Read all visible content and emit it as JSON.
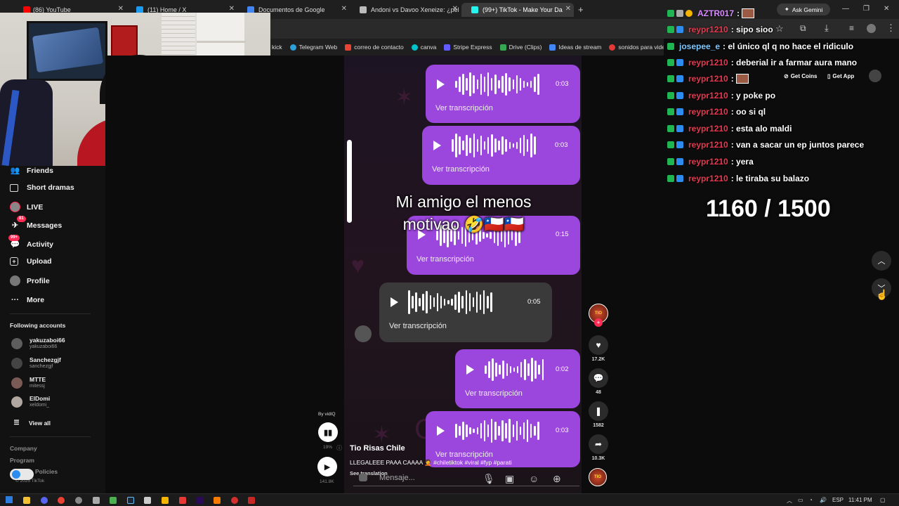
{
  "browser": {
    "tabs": [
      {
        "title": "(86) YouTube",
        "color": "#ff0000"
      },
      {
        "title": "(11) Home / X",
        "color": "#1d9bf0"
      },
      {
        "title": "Documentos de Google",
        "color": "#4285f4"
      },
      {
        "title": "Andoni vs Davoo Xeneize: ¿pel",
        "color": "#bbbbbb"
      },
      {
        "title": "(99+) TikTok - Make Your Da",
        "color": "#25f4ee"
      }
    ],
    "bookmarks": [
      {
        "label": "kick",
        "color": "#53fc18"
      },
      {
        "label": "Telegram Web",
        "color": "#2aa1da"
      },
      {
        "label": "correo de contacto",
        "color": "#ea4335"
      },
      {
        "label": "canva",
        "color": "#00c4cc"
      },
      {
        "label": "Stripe Express",
        "color": "#635bff"
      },
      {
        "label": "Drive (Clips)",
        "color": "#34a853"
      },
      {
        "label": "Ideas de stream",
        "color": "#4285f4"
      },
      {
        "label": "sonidos para videos",
        "color": "#e53935"
      }
    ],
    "gemini_label": "Ask Gemini"
  },
  "sidebar": {
    "items": [
      {
        "label": "Friends",
        "icon": "friends-icon"
      },
      {
        "label": "Short dramas",
        "icon": "short-dramas-icon"
      },
      {
        "label": "LIVE",
        "icon": "live-icon"
      },
      {
        "label": "Messages",
        "icon": "messages-icon",
        "badge": "81"
      },
      {
        "label": "Activity",
        "icon": "activity-icon",
        "badge": "99+"
      },
      {
        "label": "Upload",
        "icon": "upload-icon"
      },
      {
        "label": "Profile",
        "icon": "profile-icon"
      },
      {
        "label": "More",
        "icon": "more-icon"
      }
    ],
    "following_title": "Following accounts",
    "accounts": [
      {
        "name": "yakuzaboi66",
        "handle": "yakuzaboi66"
      },
      {
        "name": "Sanchezgjf",
        "handle": "sanchezgjf"
      },
      {
        "name": "MTTE",
        "handle": "mitessj"
      },
      {
        "name": "ElDomi",
        "handle": "xeldomi_"
      }
    ],
    "view_all": "View all",
    "footer": [
      "Company",
      "Program",
      "Policies"
    ],
    "copyright": "© 2025 TikTok"
  },
  "video": {
    "caption_line1": "Mi amigo el menos",
    "caption_line2": "motivao 🤣🇨🇱🇨🇱",
    "transcription_label": "Ver transcripción",
    "durations": [
      "0:03",
      "0:03",
      "0:15",
      "0:05",
      "0:02",
      "0:03"
    ],
    "by_label": "By vidIQ",
    "views_pct": "19%",
    "views": "141.8K",
    "author": "Tio Risas Chile",
    "description": "LLEGALEEE PAAA CAAAA 🤦 #chiletiktok #viral #fyp #parati",
    "see_translation": "See translation",
    "message_placeholder": "Mensaje..."
  },
  "actions": {
    "likes": "17.2K",
    "comments": "48",
    "saves": "1582",
    "shares": "10.3K"
  },
  "tiktok_header": {
    "get_coins": "Get Coins",
    "get_app": "Get App"
  },
  "chat": [
    {
      "user": "AZTR017",
      "msg": "",
      "user_color": "#d88cff"
    },
    {
      "user": "reypr1210",
      "msg": ": sipo sioo",
      "user_color": "#e8384f"
    },
    {
      "user": "josepee_e",
      "msg": ": el único ql q no hace el ridiculo",
      "user_color": "#7ec8ff"
    },
    {
      "user": "reypr1210",
      "msg": ": deberial ir a farmar aura mano",
      "user_color": "#e8384f"
    },
    {
      "user": "reypr1210",
      "msg": ":",
      "user_color": "#e8384f"
    },
    {
      "user": "reypr1210",
      "msg": ": y poke po",
      "user_color": "#e8384f"
    },
    {
      "user": "reypr1210",
      "msg": ": oo si ql",
      "user_color": "#e8384f"
    },
    {
      "user": "reypr1210",
      "msg": ": esta alo maldi",
      "user_color": "#e8384f"
    },
    {
      "user": "reypr1210",
      "msg": ": van a sacar un ep juntos parece",
      "user_color": "#e8384f"
    },
    {
      "user": "reypr1210",
      "msg": ": yera",
      "user_color": "#e8384f"
    },
    {
      "user": "reypr1210",
      "msg": ": le tiraba su balazo",
      "user_color": "#e8384f"
    }
  ],
  "counter": "1160 / 1500",
  "taskbar": {
    "lang": "ESP",
    "time": "11:41 PM"
  }
}
